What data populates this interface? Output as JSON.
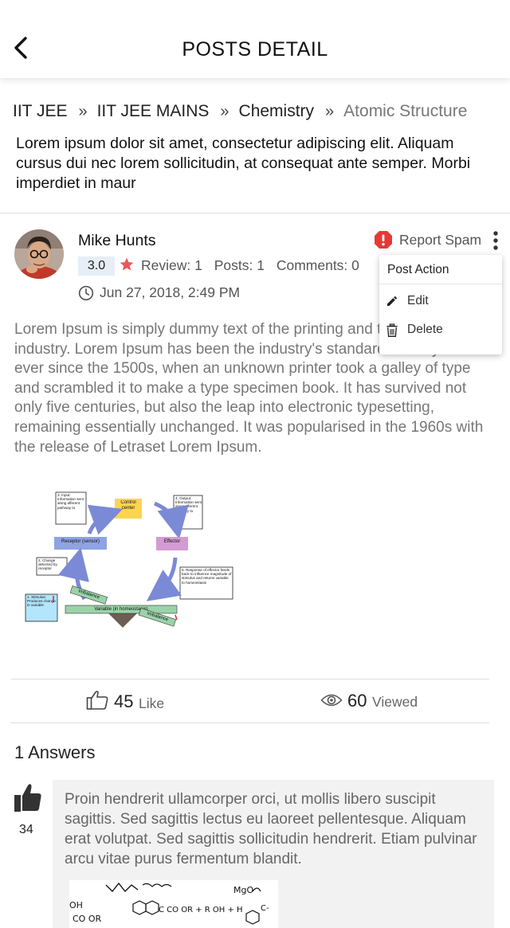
{
  "header": {
    "title": "POSTS DETAIL",
    "back_icon": "chevron-left-icon"
  },
  "breadcrumb": [
    {
      "label": "IIT JEE"
    },
    {
      "label": "IIT JEE MAINS"
    },
    {
      "label": "Chemistry"
    },
    {
      "label": "Atomic Structure"
    }
  ],
  "breadcrumb_separator": "»",
  "question": {
    "text": "Lorem ipsum dolor sit amet, consectetur adipiscing elit. Aliquam cursus dui nec lorem sollicitudin, at consequat ante semper. Morbi imperdiet in maur"
  },
  "post": {
    "author": "Mike Hunts",
    "rating": "3.0",
    "review": "Review: 1",
    "posts": "Posts: 1",
    "comments": "Comments: 0",
    "date": "Jun 27, 2018, 2:49 PM",
    "report_label": "Report Spam",
    "body": "Lorem Ipsum is simply dummy text of the printing and typesetting industry. Lorem Ipsum has been the industry's standard dummy text ever since the 1500s, when an unknown printer took a galley of type and scrambled it to make a type specimen book. It has survived not only five centuries, but also the leap into electronic typesetting, remaining essentially unchanged. It was popularised in the 1960s with the release of Letraset Lorem Ipsum.",
    "likes": "45",
    "like_label": "Like",
    "views": "60",
    "view_label": "Viewed"
  },
  "post_action_menu": {
    "title": "Post Action",
    "items": [
      {
        "label": "Edit",
        "icon": "pencil-icon"
      },
      {
        "label": "Delete",
        "icon": "trash-icon"
      }
    ]
  },
  "diagram": {
    "input_box": "3. Input: Information sent along afferent pathway to",
    "control_center": "Control center",
    "output_box": "4. Output: Information sent along efferent pathway to",
    "receptor": "Receptor (sensor)",
    "effector": "Effector",
    "change_box": "2. Change detected by receptor",
    "response_box": "5. Response of effector feeds back to influence magnitude of stimulus and returns variable to homeostasis",
    "stimulus_box": "1. Stimulus: Produces change in variable",
    "imbalance_left": "Imbalance",
    "imbalance_right": "Imbalance",
    "variable": "Variable (in homeostasis)"
  },
  "answers": {
    "title": "1 Answers",
    "items": [
      {
        "votes": "34",
        "text": "Proin hendrerit ullamcorper orci, ut mollis libero suscipit sagittis. Sed sagittis lectus eu laoreet pellentesque. Aliquam erat volutpat. Sed sagittis sollicitudin hendrerit. Etiam pulvinar arcu vitae purus fermentum blandit.",
        "image_text": [
          "OH",
          "CO OR",
          "C CO OR + R OH + H",
          "MgO",
          "C-"
        ]
      }
    ]
  },
  "colors": {
    "accent_red": "#e53935",
    "star": "#e8585a",
    "rating_bg": "#e6eef8",
    "card_bg": "#f2f2f2"
  }
}
